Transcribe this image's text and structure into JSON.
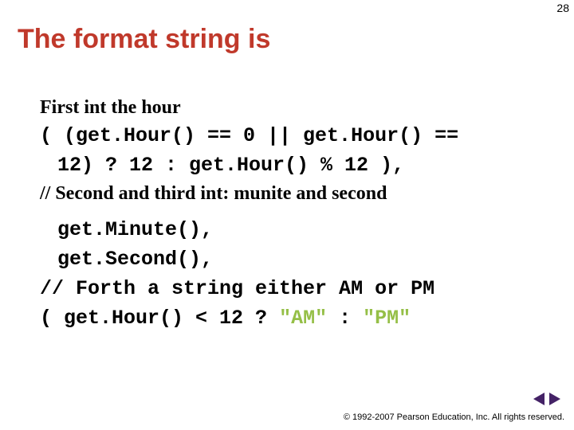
{
  "page_number": "28",
  "title": "The format string is",
  "body": {
    "line1": "First int the hour",
    "code1a": "( (get.Hour() == 0 || get.Hour() ==",
    "code1b": "12) ? 12 : get.Hour() % 12 ),",
    "line2": "// Second and third int: munite and second",
    "code2a": "get.Minute(),",
    "code2b": "get.Second(),",
    "code3": "//  Forth a string either AM or PM",
    "code4_pre": " ( get.Hour() < 12 ? ",
    "code4_am": "\"AM\"",
    "code4_mid": " : ",
    "code4_pm": "\"PM\""
  },
  "footer": "© 1992-2007 Pearson Education, Inc. All rights reserved.",
  "nav": {
    "prev": "prev-slide",
    "next": "next-slide"
  }
}
